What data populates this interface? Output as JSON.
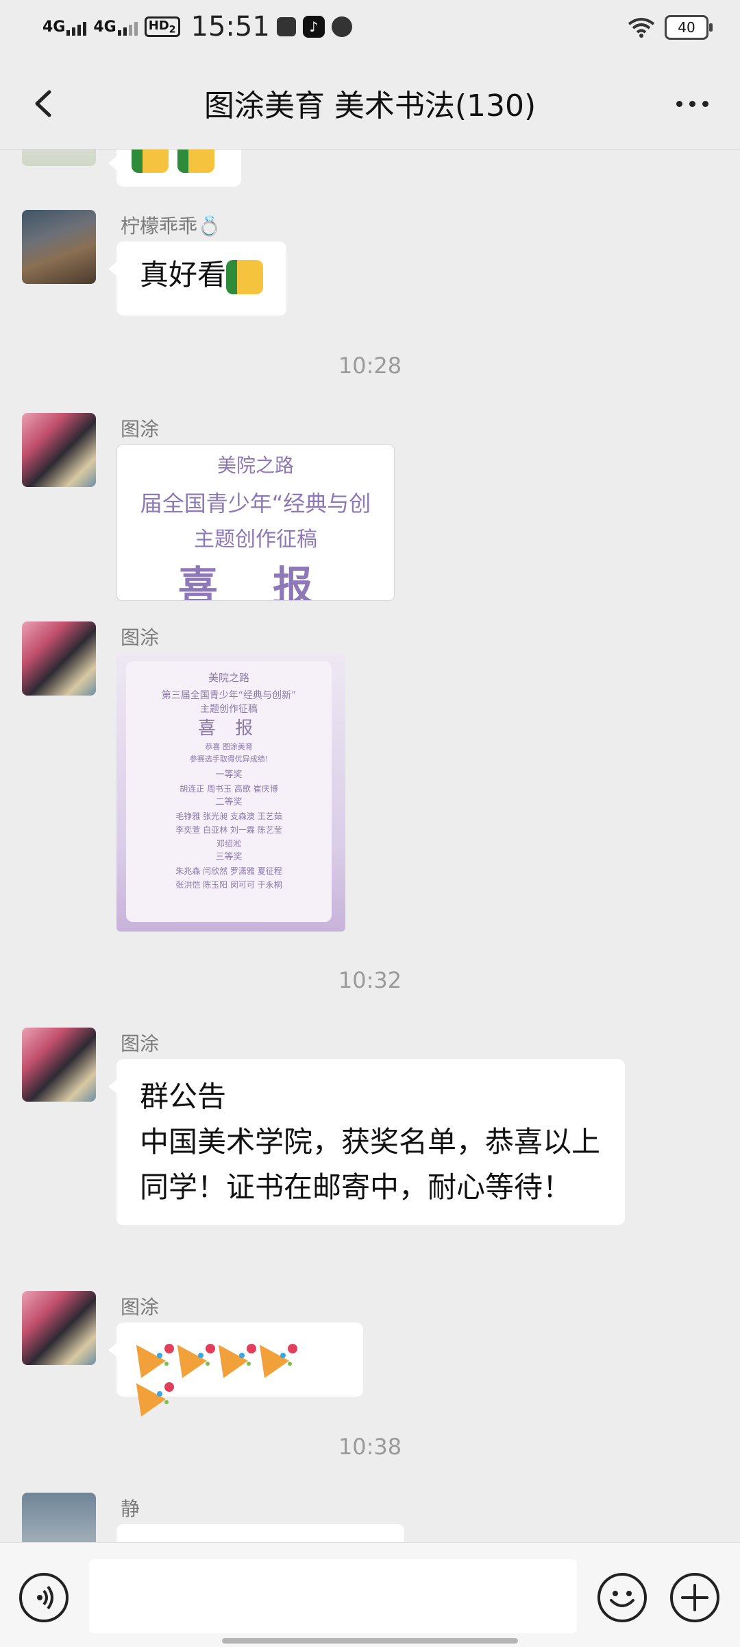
{
  "status_bar": {
    "signal1": "4G",
    "signal2": "4G",
    "hd_badge": "HD",
    "hd_sub": "2",
    "time": "15:51",
    "battery": "40"
  },
  "header": {
    "title": "图涂美育 美术书法(130)"
  },
  "messages": [
    {
      "sender": "柠檬乖乖💍",
      "text": "真好看"
    },
    {
      "timestamp": "10:28"
    },
    {
      "sender": "图涂",
      "poster": {
        "line1": "美院之路",
        "line2": "届全国青少年“经典与创",
        "line3": "主题创作征稿",
        "line4": "喜 报"
      }
    },
    {
      "sender": "图涂",
      "poster_full": {
        "line1": "美院之路",
        "line2": "第三届全国青少年“经典与创新”",
        "line3": "主题创作征稿",
        "line4": "喜 报",
        "line5": "恭喜 图涂美育",
        "line6": "参赛选手取得优异成绩!",
        "prize1": "一等奖",
        "prize1_names": "胡连正  周书玉  高歌  崔庆博",
        "prize2": "二等奖",
        "prize2_names_a": "毛铮雅  张光昶  支森澳  王艺茹",
        "prize2_names_b": "李奕萱  白亚林  刘一霖  陈艺莹",
        "prize2_names_c": "邓绍淞",
        "prize3": "三等奖",
        "prize3_names_a": "朱兆森  闫欣然  罗潇雅  夏征程",
        "prize3_names_b": "张洪恺  陈玉阳  闵可可  于永桐"
      }
    },
    {
      "timestamp": "10:32"
    },
    {
      "sender": "图涂",
      "announcement_title": "群公告",
      "announcement_body": "中国美术学院，获奖名单，恭喜以上同学！证书在邮寄中，耐心等待！"
    },
    {
      "sender": "图涂",
      "emoji_row": "party-popper x5"
    },
    {
      "timestamp": "10:38"
    },
    {
      "sender": "静"
    }
  ]
}
